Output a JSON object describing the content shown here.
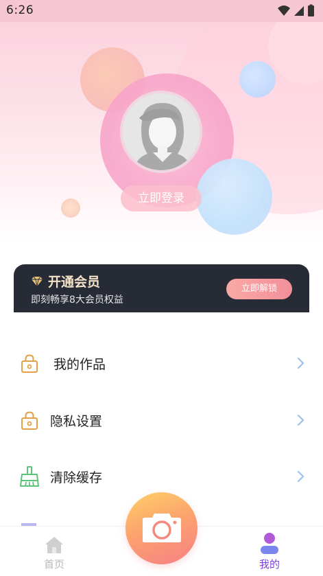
{
  "status_bar": {
    "time": "6:26",
    "icons": [
      "wifi-icon",
      "signal-icon",
      "battery-icon"
    ]
  },
  "profile": {
    "login_button": "立即登录"
  },
  "vip": {
    "title": "开通会员",
    "subtitle": "即刻畅享8大会员权益",
    "unlock_button": "立即解锁",
    "colors": {
      "card_bg": "#262b36",
      "title": "#f3e2c8",
      "button": "#f28f9a"
    }
  },
  "menu": {
    "items": [
      {
        "label": "我的作品",
        "icon": "lock-icon"
      },
      {
        "label": "隐私设置",
        "icon": "lock-icon"
      },
      {
        "label": "清除缓存",
        "icon": "broom-icon"
      }
    ]
  },
  "bottom_nav": {
    "home_label": "首页",
    "mine_label": "我的",
    "active": "我的",
    "colors": {
      "active": "#7b3fd9",
      "inactive": "#b8b8b8"
    }
  }
}
